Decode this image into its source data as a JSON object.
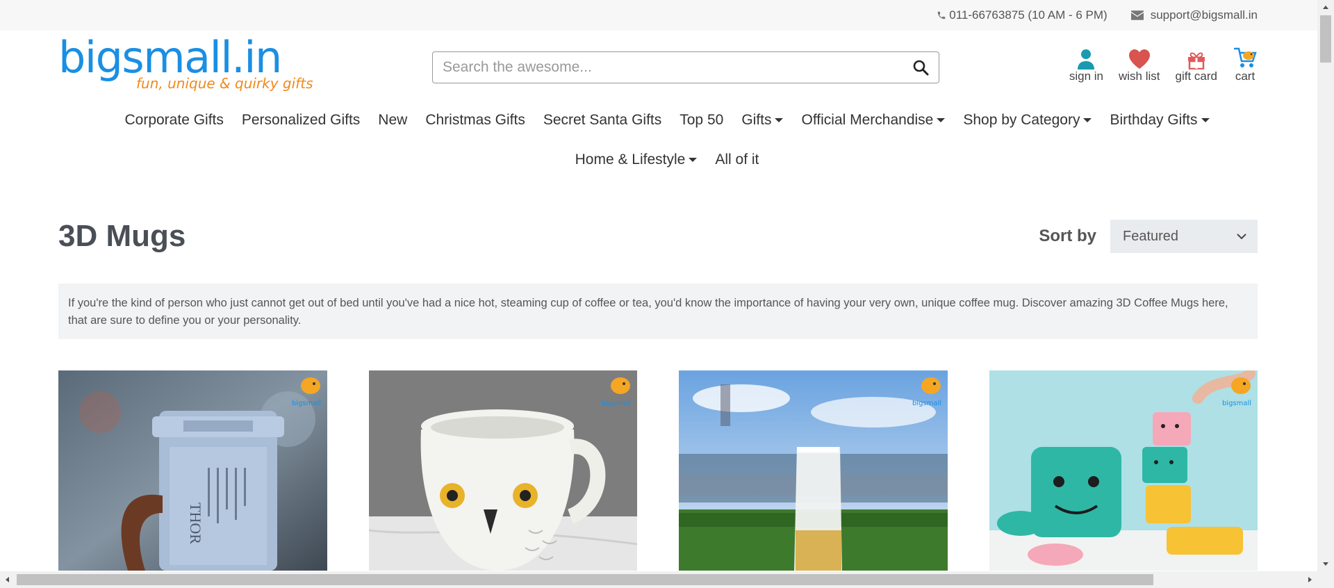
{
  "topbar": {
    "phone": "011-66763875 (10 AM - 6 PM)",
    "email": "support@bigsmall.in"
  },
  "logo": {
    "name": "bigsmall.in",
    "tagline": "fun, unique & quirky gifts"
  },
  "search": {
    "placeholder": "Search the awesome..."
  },
  "user_nav": {
    "sign_in": "sign in",
    "wish_list": "wish list",
    "gift_card": "gift card",
    "cart": "cart"
  },
  "menu": [
    {
      "label": "Corporate Gifts",
      "dropdown": false
    },
    {
      "label": "Personalized Gifts",
      "dropdown": false
    },
    {
      "label": "New",
      "dropdown": false
    },
    {
      "label": "Christmas Gifts",
      "dropdown": false
    },
    {
      "label": "Secret Santa Gifts",
      "dropdown": false
    },
    {
      "label": "Top 50",
      "dropdown": false
    },
    {
      "label": "Gifts",
      "dropdown": true
    },
    {
      "label": "Official Merchandise",
      "dropdown": true
    },
    {
      "label": "Shop by Category",
      "dropdown": true
    },
    {
      "label": "Birthday Gifts",
      "dropdown": true
    },
    {
      "label": "Home & Lifestyle",
      "dropdown": true
    },
    {
      "label": "All of it",
      "dropdown": false
    }
  ],
  "page": {
    "title": "3D Mugs",
    "sort_label": "Sort by",
    "sort_value": "Featured",
    "description": "If you're the kind of person who just cannot get out of bed until you've had a nice hot, steaming cup of coffee or tea, you'd know the importance of having your very own, unique coffee mug. Discover amazing 3D Coffee Mugs here, that are sure to define you or your personality."
  },
  "products": [
    {
      "image": "thor-hammer-mug",
      "engraving": "THOR"
    },
    {
      "image": "owl-mug"
    },
    {
      "image": "beer-boot-glass"
    },
    {
      "image": "dino-kids-set"
    }
  ],
  "colors": {
    "brand_blue": "#1a8fe3",
    "brand_orange": "#f08a1c",
    "sign_in_icon": "#1a9ab0",
    "wish_icon": "#d9534f",
    "gift_icon": "#e05a5a"
  }
}
